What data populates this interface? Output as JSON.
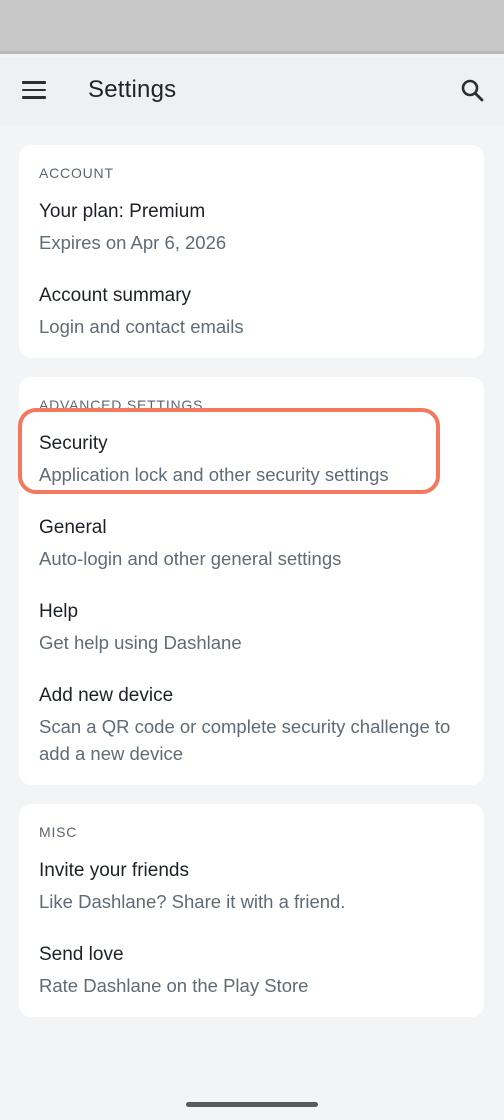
{
  "header": {
    "title": "Settings"
  },
  "icons": {
    "menu": "hamburger-menu-icon",
    "search": "search-icon"
  },
  "sections": [
    {
      "label": "ACCOUNT",
      "items": [
        {
          "title": "Your plan: Premium",
          "subtitle": "Expires on Apr 6, 2026"
        },
        {
          "title": "Account summary",
          "subtitle": "Login and contact emails"
        }
      ]
    },
    {
      "label": "ADVANCED SETTINGS",
      "items": [
        {
          "title": "Security",
          "subtitle": "Application lock and other security settings"
        },
        {
          "title": "General",
          "subtitle": "Auto-login and other general settings"
        },
        {
          "title": "Help",
          "subtitle": "Get help using Dashlane"
        },
        {
          "title": "Add new device",
          "subtitle": "Scan a QR code or complete security challenge to add a new device"
        }
      ]
    },
    {
      "label": "MISC",
      "items": [
        {
          "title": "Invite your friends",
          "subtitle": "Like Dashlane? Share it with a friend."
        },
        {
          "title": "Send love",
          "subtitle": "Rate Dashlane on the Play Store"
        }
      ]
    }
  ],
  "colors": {
    "highlight": "#f2785e",
    "background": "#f2f4f5",
    "card": "#ffffff"
  }
}
